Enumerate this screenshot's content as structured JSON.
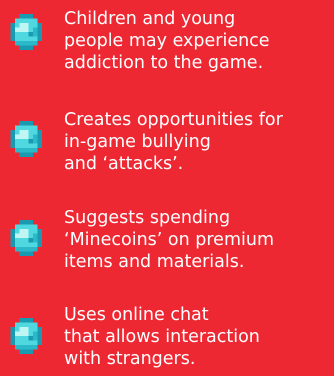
{
  "icon": "diamond-gem-icon",
  "colors": {
    "background": "#ee2833",
    "text": "#ffffff",
    "gem_light": "#bff6f4",
    "gem_mid": "#4fd8e0",
    "gem_dark": "#1a9ab0"
  },
  "items": [
    {
      "lines": [
        "Children and young",
        "people may experience",
        "addiction to the game."
      ]
    },
    {
      "lines": [
        "Creates opportunities for",
        "in-game bullying",
        "and ‘attacks’."
      ]
    },
    {
      "lines": [
        "Suggests spending",
        "‘Minecoins’ on premium",
        "items and materials."
      ]
    },
    {
      "lines": [
        "Uses online chat",
        "that allows interaction",
        "with strangers."
      ]
    }
  ]
}
